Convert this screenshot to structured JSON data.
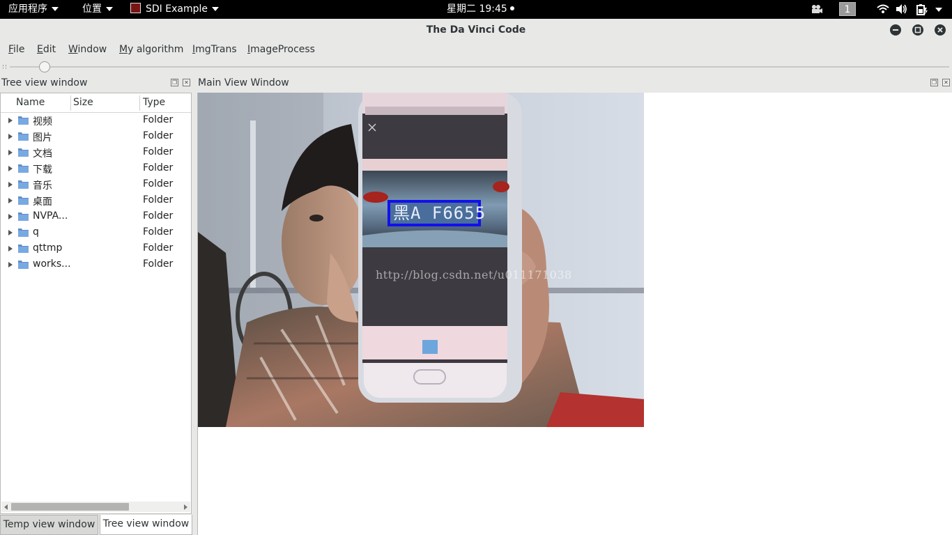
{
  "topbar": {
    "apps_menu": "应用程序",
    "places_menu": "位置",
    "active_app": "SDI Example",
    "clock": "星期二 19:45",
    "workspace": "1"
  },
  "window": {
    "title": "The Da Vinci Code"
  },
  "menubar": {
    "items": [
      {
        "mnemonic": "F",
        "rest": "ile"
      },
      {
        "mnemonic": "E",
        "rest": "dit"
      },
      {
        "mnemonic": "W",
        "rest": "indow"
      },
      {
        "mnemonic": "M",
        "rest": "y algorithm"
      },
      {
        "mnemonic": "I",
        "rest": "mgTrans"
      },
      {
        "mnemonic": "I",
        "rest": "mageProcess"
      }
    ]
  },
  "tree_dock": {
    "title": "Tree view window",
    "columns": [
      "Name",
      "Size",
      "Type"
    ],
    "rows": [
      {
        "name": "视频",
        "type": "Folder"
      },
      {
        "name": "图片",
        "type": "Folder"
      },
      {
        "name": "文档",
        "type": "Folder"
      },
      {
        "name": "下载",
        "type": "Folder"
      },
      {
        "name": "音乐",
        "type": "Folder"
      },
      {
        "name": "桌面",
        "type": "Folder"
      },
      {
        "name": "NVPA...",
        "type": "Folder"
      },
      {
        "name": "q",
        "type": "Folder"
      },
      {
        "name": "qttmp",
        "type": "Folder"
      },
      {
        "name": "works...",
        "type": "Folder"
      }
    ]
  },
  "tabs": [
    "Temp view window",
    "Tree view window"
  ],
  "main_dock": {
    "title": "Main View Window",
    "plate_text": "黑A F6655",
    "watermark": "http://blog.csdn.net/u011171038"
  },
  "colors": {
    "detection_box": "#1010ee",
    "folder_icon": "#5b8fcf"
  }
}
